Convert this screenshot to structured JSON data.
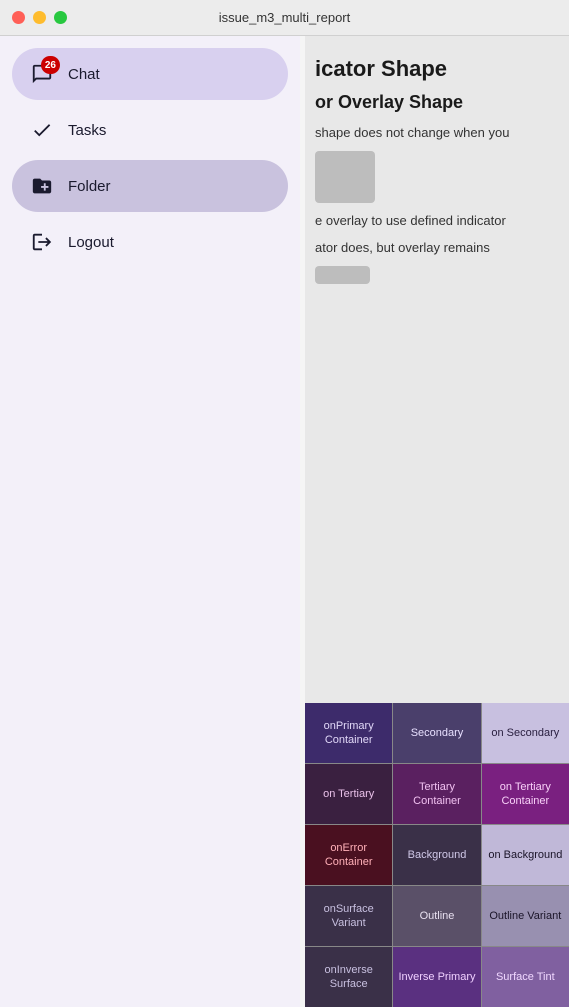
{
  "titlebar": {
    "title": "issue_m3_multi_report"
  },
  "sidebar": {
    "items": [
      {
        "id": "chat",
        "label": "Chat",
        "icon": "chat-icon",
        "active": true,
        "badge": "26"
      },
      {
        "id": "tasks",
        "label": "Tasks",
        "icon": "tasks-icon",
        "active": false,
        "badge": null
      },
      {
        "id": "folder",
        "label": "Folder",
        "icon": "folder-icon",
        "active": false,
        "badge": null
      },
      {
        "id": "logout",
        "label": "Logout",
        "icon": "logout-icon",
        "active": false,
        "badge": null
      }
    ]
  },
  "content": {
    "title1": "icator Shape",
    "title2": "or Overlay Shape",
    "text1": "shape does not change when you",
    "text2": "e overlay to use defined indicator",
    "text3": "ator does, but overlay remains"
  },
  "colorGrid": {
    "rows": [
      [
        {
          "label": "onPrimary\nContainer",
          "bg": "#3d2b6b",
          "color": "#e0d7f7"
        },
        {
          "label": "Secondary",
          "bg": "#4a3f6b",
          "color": "#e8e0ff"
        },
        {
          "label": "on\nSecondary",
          "bg": "#c8c0e0",
          "color": "#2a2040"
        }
      ],
      [
        {
          "label": "on\nTertiary",
          "bg": "#3a2040",
          "color": "#e8c0e8"
        },
        {
          "label": "Tertiary\nContainer",
          "bg": "#5a2060",
          "color": "#f0c0f0"
        },
        {
          "label": "on\nTertiary\nContainer",
          "bg": "#7a2080",
          "color": "#f8d0f8"
        }
      ],
      [
        {
          "label": "onError\nContainer",
          "bg": "#4a1020",
          "color": "#ffb0b8"
        },
        {
          "label": "Background",
          "bg": "#3a3048",
          "color": "#d0c8e8"
        },
        {
          "label": "on\nBackground",
          "bg": "#c0b8d8",
          "color": "#1a1428"
        }
      ],
      [
        {
          "label": "onSurface\nVariant",
          "bg": "#3a3048",
          "color": "#c8c0e0"
        },
        {
          "label": "Outline",
          "bg": "#5a5068",
          "color": "#e8e0f0"
        },
        {
          "label": "Outline\nVariant",
          "bg": "#9890b0",
          "color": "#1a1428"
        }
      ],
      [
        {
          "label": "onInverse\nSurface",
          "bg": "#3a3048",
          "color": "#c8c0e0"
        },
        {
          "label": "Inverse\nPrimary",
          "bg": "#5a3080",
          "color": "#f0d0ff"
        },
        {
          "label": "Surface\nTint",
          "bg": "#8060a0",
          "color": "#f0d8ff"
        }
      ]
    ]
  }
}
